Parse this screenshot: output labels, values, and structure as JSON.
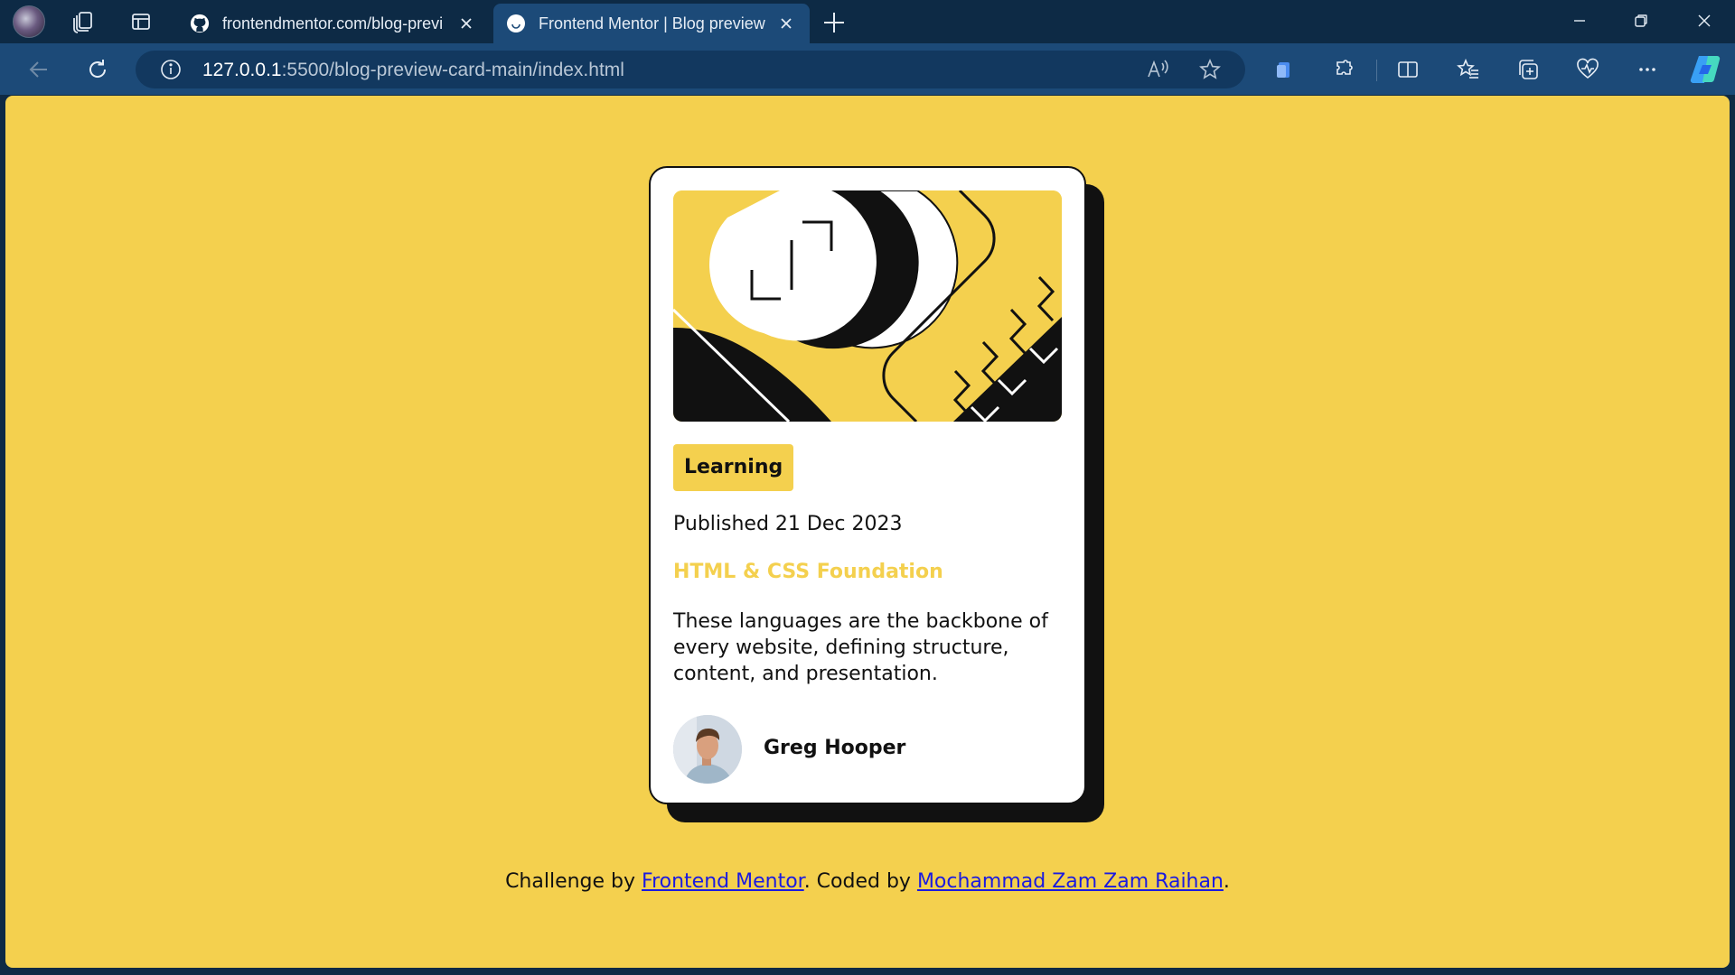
{
  "browser": {
    "tabs": [
      {
        "title": "frontendmentor.com/blog-previ",
        "favicon": "github-icon",
        "active": false
      },
      {
        "title": "Frontend Mentor | Blog preview",
        "favicon": "page-icon",
        "active": true
      }
    ],
    "address": {
      "host": "127.0.0.1",
      "rest": ":5500/blog-preview-card-main/index.html"
    }
  },
  "card": {
    "tag": "Learning",
    "published": "Published 21 Dec 2023",
    "title": "HTML & CSS Foundation",
    "description": "These languages are the backbone of every website, defining structure, content, and presentation.",
    "author": "Greg Hooper"
  },
  "footer": {
    "prefix": "Challenge by ",
    "link1": "Frontend Mentor",
    "middle": ". Coded by ",
    "link2": "Mochammad Zam Zam Raihan",
    "suffix": "."
  },
  "colors": {
    "page_background": "#f4d04e",
    "card_background": "#ffffff",
    "ink": "#111111",
    "accent": "#f4d04e",
    "link": "#1a1ae0",
    "browser_frame": "#0d2a45",
    "browser_toolbar": "#1c4a78"
  }
}
